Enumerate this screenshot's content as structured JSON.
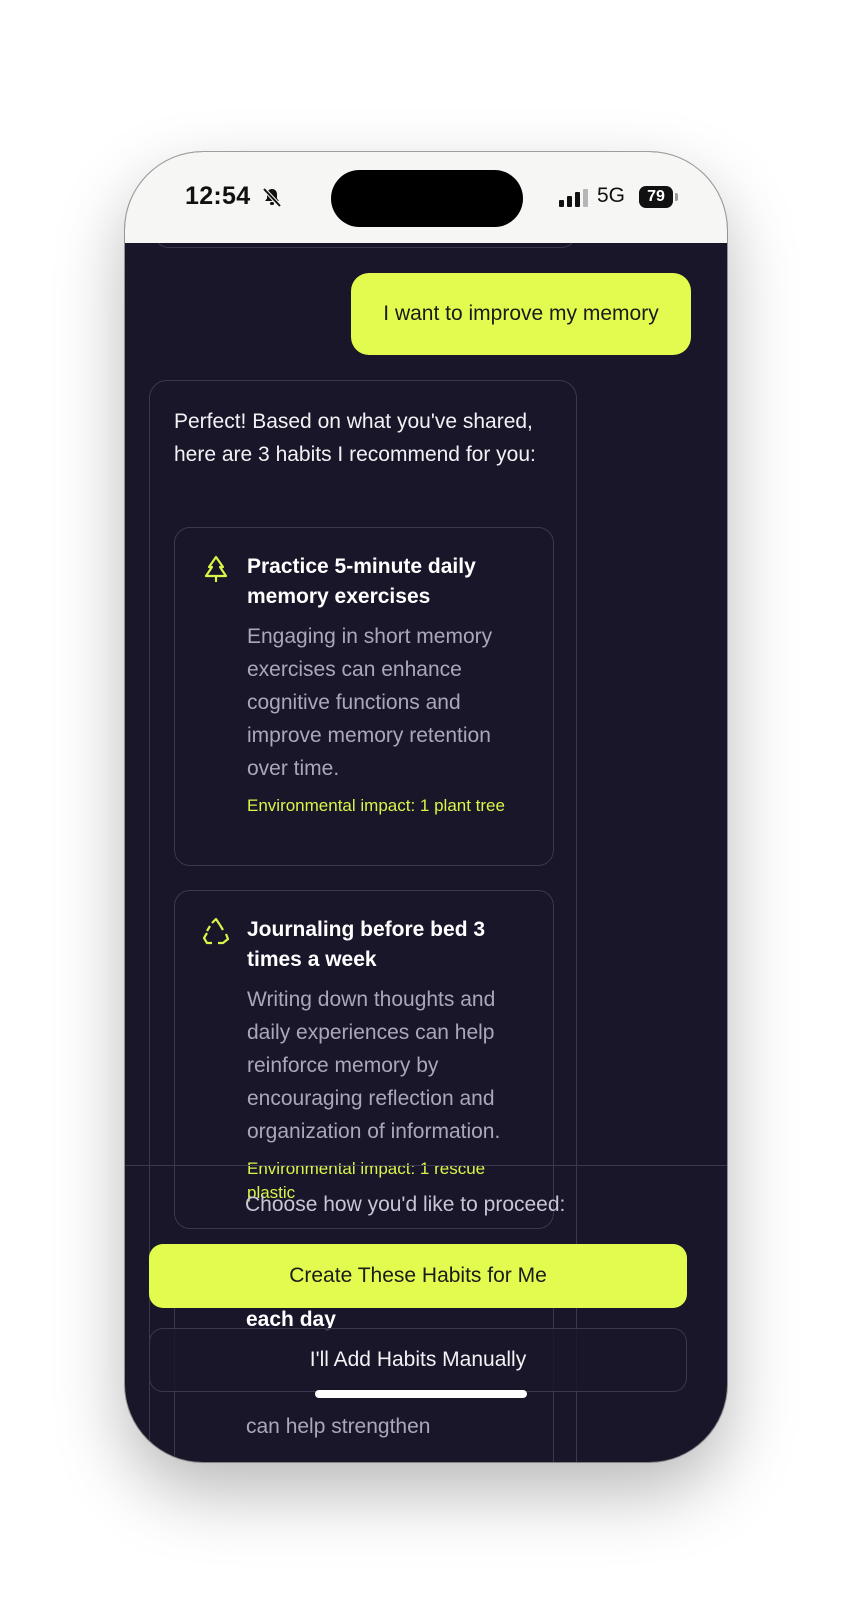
{
  "status_bar": {
    "time": "12:54",
    "network": "5G",
    "battery": "79",
    "icons": [
      "bell-slash-icon",
      "signal-icon"
    ]
  },
  "chat": {
    "user_message": "I want to improve my memory",
    "ai_intro": "Perfect! Based on what you've shared, here are 3 habits I recommend for you:",
    "habits": [
      {
        "icon": "tree-icon",
        "title": "Practice 5-minute daily memory exercises",
        "description": "Engaging in short memory exercises can enhance cognitive functions and improve memory retention over time.",
        "impact": "Environmental impact: 1 plant tree"
      },
      {
        "icon": "recycle-icon",
        "title": "Journaling before bed 3 times a week",
        "description": "Writing down thoughts and daily experiences can help reinforce memory by encouraging reflection and organization of information.",
        "impact": "Environmental impact: 1 rescue plastic"
      }
    ],
    "partial_title_fragment": "each day",
    "partial_desc_fragment": "can help strengthen"
  },
  "actions": {
    "prompt": "Choose how you'd like to proceed:",
    "primary_label": "Create These Habits for Me",
    "secondary_label": "I'll Add Habits Manually"
  },
  "colors": {
    "background": "#181628",
    "accent": "#e2fb4e",
    "border": "#3a384d",
    "muted_text": "#a9a7b8"
  }
}
